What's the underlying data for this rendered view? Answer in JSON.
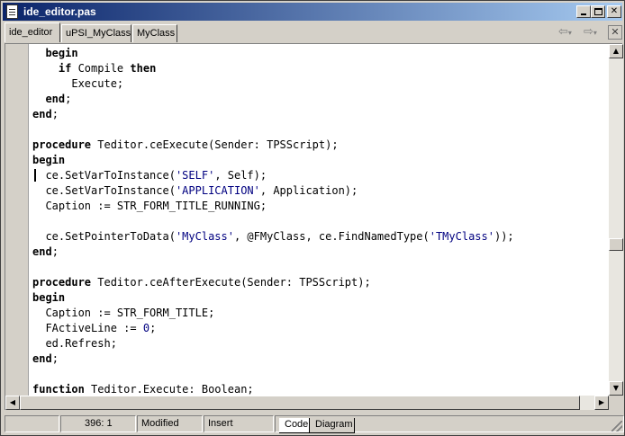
{
  "window": {
    "title": "ide_editor.pas"
  },
  "tabs": [
    {
      "label": "ide_editor",
      "active": true
    },
    {
      "label": "uPSI_MyClass",
      "active": false
    },
    {
      "label": "MyClass",
      "active": false
    }
  ],
  "icons": {
    "back": "arrow-left-icon",
    "forward": "arrow-right-icon",
    "close": "close-icon"
  },
  "nav_glyphs": {
    "back": "⇦",
    "back_drop": "▾",
    "forward": "⇨",
    "forward_drop": "▾",
    "close": "✕",
    "up": "▲",
    "down": "▼",
    "left": "◀",
    "right": "▶"
  },
  "code_lines": [
    [
      {
        "t": "  "
      },
      {
        "t": "begin",
        "c": "kw"
      }
    ],
    [
      {
        "t": "    "
      },
      {
        "t": "if",
        "c": "kw"
      },
      {
        "t": " Compile "
      },
      {
        "t": "then",
        "c": "kw"
      }
    ],
    [
      {
        "t": "      Execute;"
      }
    ],
    [
      {
        "t": "  "
      },
      {
        "t": "end",
        "c": "kw"
      },
      {
        "t": ";"
      }
    ],
    [
      {
        "t": "end",
        "c": "kw"
      },
      {
        "t": ";"
      }
    ],
    [
      {
        "t": ""
      }
    ],
    [
      {
        "t": "procedure",
        "c": "kw"
      },
      {
        "t": " Teditor.ceExecute(Sender: TPSScript);"
      }
    ],
    [
      {
        "t": "begin",
        "c": "kw"
      }
    ],
    [
      {
        "t": "  ce.SetVarToInstance("
      },
      {
        "t": "'SELF'",
        "c": "str"
      },
      {
        "t": ", Self);"
      }
    ],
    [
      {
        "t": "  ce.SetVarToInstance("
      },
      {
        "t": "'APPLICATION'",
        "c": "str"
      },
      {
        "t": ", Application);"
      }
    ],
    [
      {
        "t": "  Caption := STR_FORM_TITLE_RUNNING;"
      }
    ],
    [
      {
        "t": ""
      }
    ],
    [
      {
        "t": "  ce.SetPointerToData("
      },
      {
        "t": "'MyClass'",
        "c": "str"
      },
      {
        "t": ", @FMyClass, ce.FindNamedType("
      },
      {
        "t": "'TMyClass'",
        "c": "str"
      },
      {
        "t": "));"
      }
    ],
    [
      {
        "t": "end",
        "c": "kw"
      },
      {
        "t": ";"
      }
    ],
    [
      {
        "t": ""
      }
    ],
    [
      {
        "t": "procedure",
        "c": "kw"
      },
      {
        "t": " Teditor.ceAfterExecute(Sender: TPSScript);"
      }
    ],
    [
      {
        "t": "begin",
        "c": "kw"
      }
    ],
    [
      {
        "t": "  Caption := STR_FORM_TITLE;"
      }
    ],
    [
      {
        "t": "  FActiveLine := "
      },
      {
        "t": "0",
        "c": "str"
      },
      {
        "t": ";"
      }
    ],
    [
      {
        "t": "  ed.Refresh;"
      }
    ],
    [
      {
        "t": "end",
        "c": "kw"
      },
      {
        "t": ";"
      }
    ],
    [
      {
        "t": ""
      }
    ],
    [
      {
        "t": "function",
        "c": "kw"
      },
      {
        "t": " Teditor.Execute: Boolean;"
      }
    ]
  ],
  "status": {
    "position": "396:  1",
    "modified": "Modified",
    "mode": "Insert",
    "tabs": [
      "Code",
      "Diagram"
    ]
  },
  "scroll": {
    "vertical_fraction": 0.58
  }
}
